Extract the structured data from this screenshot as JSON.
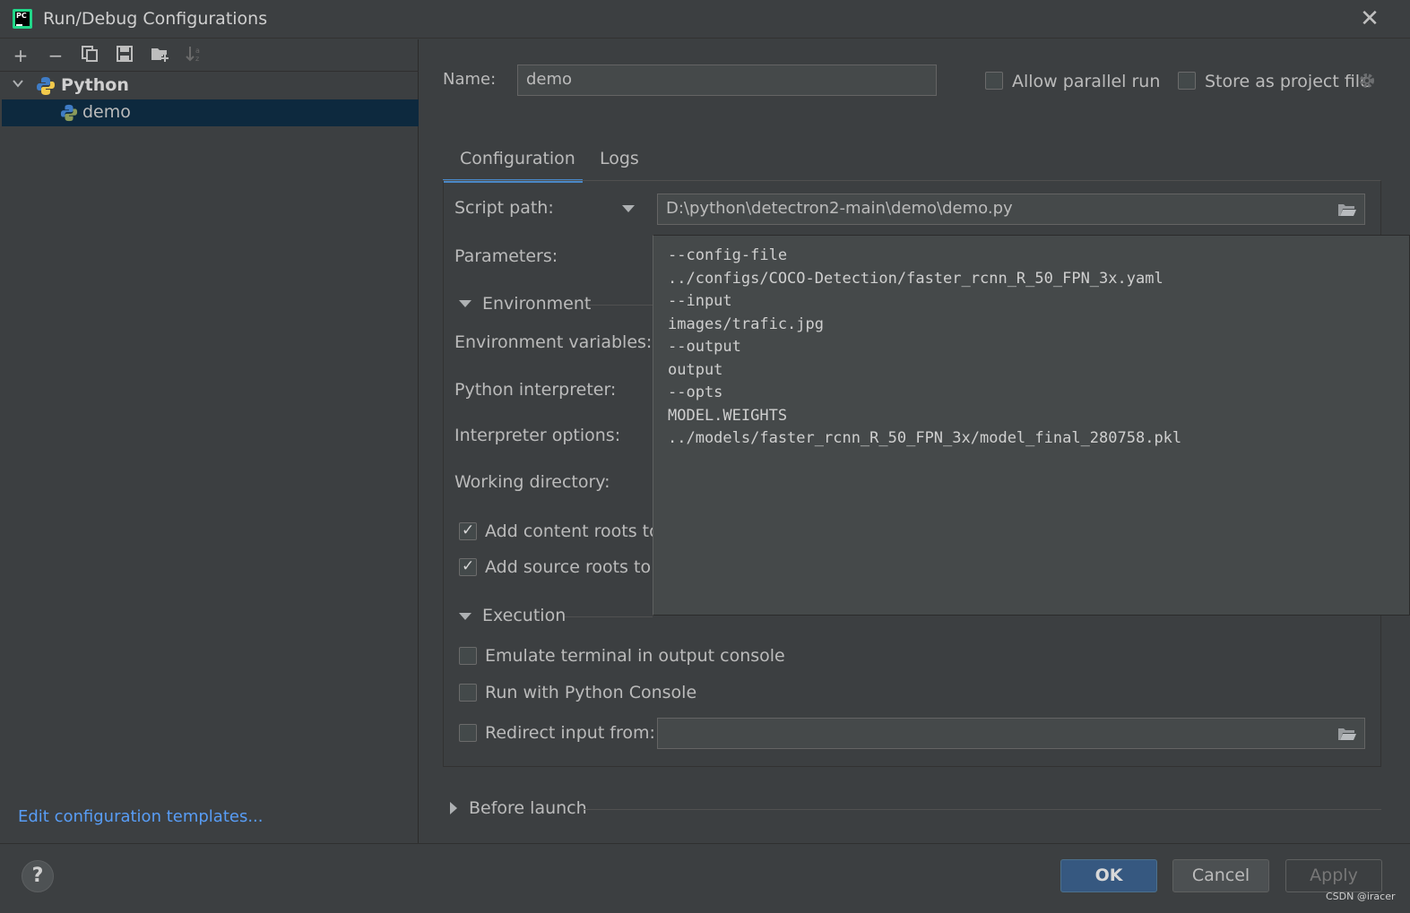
{
  "window": {
    "title": "Run/Debug Configurations",
    "icon": "pycharm-icon"
  },
  "toolbar": {
    "icons": [
      "plus-icon",
      "minus-icon",
      "copy-icon",
      "save-icon",
      "new-folder-icon",
      "sort-icon"
    ]
  },
  "tree": {
    "group_label": "Python",
    "selected_item": "demo"
  },
  "left_footer": {
    "edit_templates_link": "Edit configuration templates..."
  },
  "header": {
    "name_label": "Name:",
    "name_value": "demo",
    "allow_parallel_label": "Allow parallel run",
    "allow_parallel_checked": false,
    "store_project_label": "Store as project file",
    "store_project_checked": false
  },
  "tabs": [
    {
      "label": "Configuration",
      "active": true
    },
    {
      "label": "Logs",
      "active": false
    }
  ],
  "configuration": {
    "script_path_label": "Script path:",
    "script_path_value": "D:\\python\\detectron2-main\\demo\\demo.py",
    "parameters_label": "Parameters:",
    "environment_section": "Environment",
    "env_vars_label": "Environment variables:",
    "python_interpreter_label": "Python interpreter:",
    "interpreter_options_label": "Interpreter options:",
    "working_dir_label": "Working directory:",
    "add_content_roots_label": "Add content roots to",
    "add_content_roots_checked": true,
    "add_source_roots_label": "Add source roots to P",
    "add_source_roots_checked": true,
    "execution_section": "Execution",
    "emulate_terminal_label": "Emulate terminal in output console",
    "emulate_terminal_checked": false,
    "run_python_console_label": "Run with Python Console",
    "run_python_console_checked": false,
    "redirect_input_label": "Redirect input from:",
    "redirect_input_checked": false,
    "redirect_input_value": ""
  },
  "parameters_lines": [
    "--config-file",
    "../configs/COCO-Detection/faster_rcnn_R_50_FPN_3x.yaml",
    "--input",
    "images/trafic.jpg",
    "--output",
    "output",
    "--opts",
    "MODEL.WEIGHTS",
    "../models/faster_rcnn_R_50_FPN_3x/model_final_280758.pkl"
  ],
  "before_launch": {
    "label": "Before launch"
  },
  "buttons": {
    "ok": "OK",
    "cancel": "Cancel",
    "apply": "Apply",
    "help": "?"
  },
  "watermark": "CSDN @iracer"
}
